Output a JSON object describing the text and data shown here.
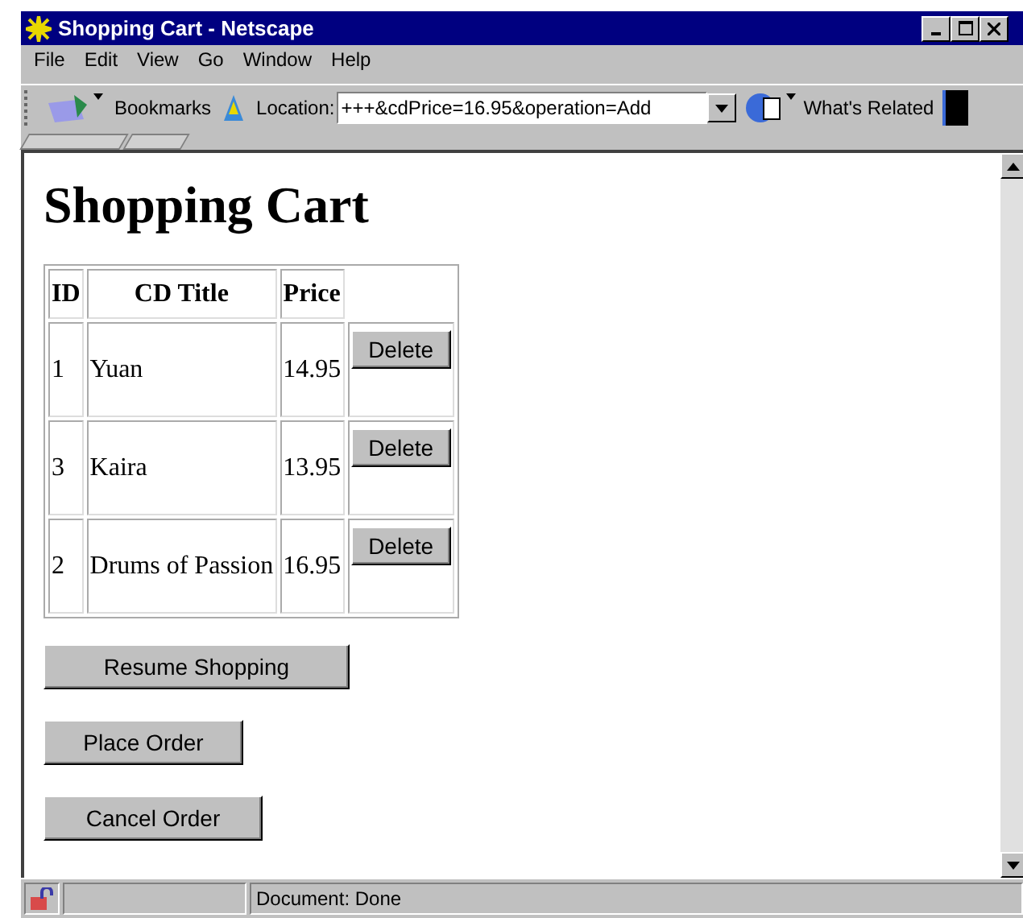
{
  "window": {
    "title": "Shopping Cart - Netscape"
  },
  "menu": [
    "File",
    "Edit",
    "View",
    "Go",
    "Window",
    "Help"
  ],
  "toolbar": {
    "bookmarks": "Bookmarks",
    "location_label": "Location:",
    "location_value": "+++&cdPrice=16.95&operation=Add",
    "related": "What's Related"
  },
  "page": {
    "heading": "Shopping Cart",
    "table": {
      "columns": [
        "ID",
        "CD Title",
        "Price"
      ],
      "rows": [
        {
          "id": "1",
          "title": "Yuan",
          "price": "14.95",
          "action": "Delete"
        },
        {
          "id": "3",
          "title": "Kaira",
          "price": "13.95",
          "action": "Delete"
        },
        {
          "id": "2",
          "title": "Drums of Passion",
          "price": "16.95",
          "action": "Delete"
        }
      ]
    },
    "buttons": [
      "Resume Shopping",
      "Place Order",
      "Cancel Order"
    ]
  },
  "status_bar": {
    "text": "Document: Done"
  }
}
